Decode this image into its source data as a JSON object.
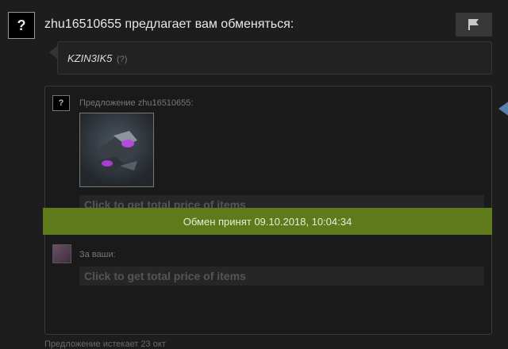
{
  "header": {
    "avatar_placeholder": "?",
    "title": "zhu16510655 предлагает вам обменяться:"
  },
  "message": {
    "name": "KZIN3IK5",
    "hint": "(?)"
  },
  "offer": {
    "avatar_placeholder": "?",
    "their_label": "Предложение zhu16510655:",
    "price_link": "Click to get total price of items",
    "yours_label": "За ваши:",
    "yours_price_link": "Click to get total price of items"
  },
  "status_banner": "Обмен принят 09.10.2018, 10:04:34",
  "footer": {
    "expires": "Предложение истекает 23 окт"
  },
  "colors": {
    "background": "#1d1d1d",
    "banner": "#5e7a1a",
    "side_arrow": "#5a7fa8"
  }
}
